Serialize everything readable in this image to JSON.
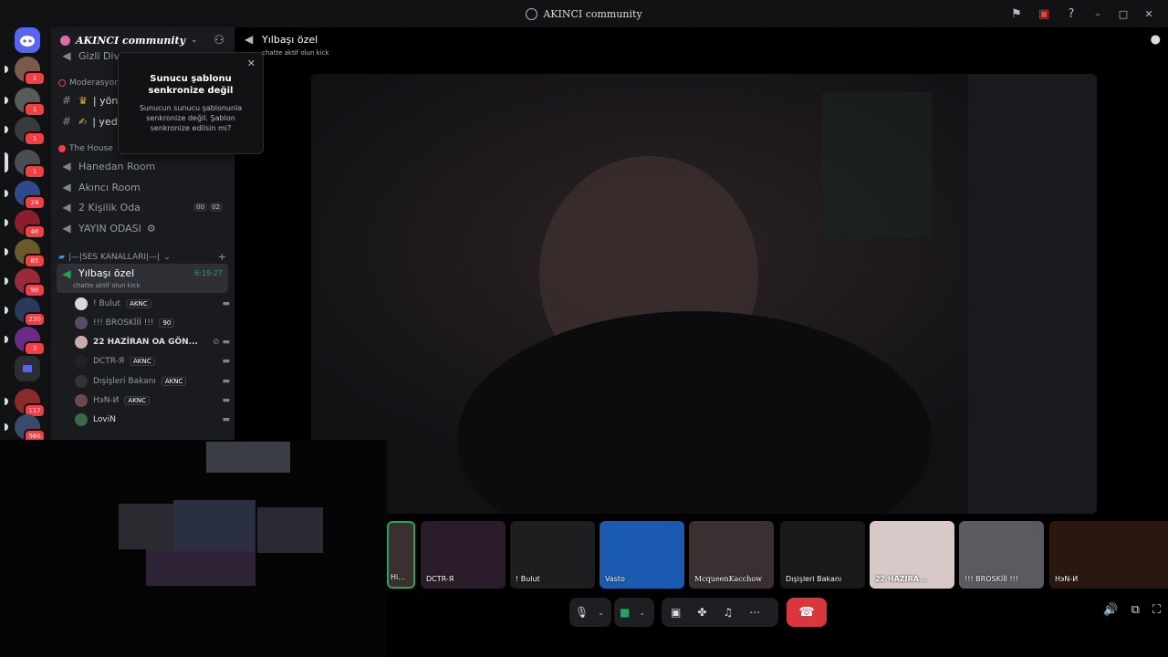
{
  "window": {
    "title": "AKINCI community",
    "icons": [
      "flag-icon",
      "screen-share-icon",
      "help-icon",
      "minimize-icon",
      "maximize-icon",
      "close-icon"
    ]
  },
  "rail": {
    "badges": [
      "1",
      "1",
      "1",
      "1",
      "24",
      "46",
      "85",
      "98",
      "220",
      "3",
      "117",
      "566"
    ]
  },
  "guild": {
    "name": "AKINCI community"
  },
  "channels": {
    "gizli": "Gizli Divan",
    "cat_moderasyon": "Moderasyon",
    "yonetim": "| yönet",
    "yedek": "| yedek",
    "cat_house": "The House",
    "hanedan": "Hanedan Room",
    "akinci_room": "Akıncı Room",
    "iki_kisilik": "2 Kişilik Oda",
    "iki_kisilik_counts": [
      "00",
      "02"
    ],
    "yayin": "YAYIN ODASI",
    "cat_ses": "|—|SES KANALLARI|—|",
    "active": {
      "name": "Yılbaşı özel",
      "timer": "6:19:27",
      "status": "chatte aktif olun kick"
    }
  },
  "voice_users": [
    {
      "name": "! Bulut",
      "tag": "AKNC"
    },
    {
      "name": "!!! BROSKİİİ !!!",
      "tag": "90"
    },
    {
      "name": "22 HAZİRAN OA GÖN...",
      "tag": ""
    },
    {
      "name": "DCTR-Я",
      "tag": "AKNC"
    },
    {
      "name": "Dışişleri Bakanı",
      "tag": "AKNC"
    },
    {
      "name": "HэN-И",
      "tag": "AKNC"
    },
    {
      "name": "LoviN",
      "tag": ""
    }
  ],
  "popup": {
    "title": "Sunucu şablonu senkronize değil",
    "body": "Sunucun sunucu şablonunla senkronize değil. Şablon senkronize edilsin mi?"
  },
  "call": {
    "title": "Yılbaşı özel",
    "status": "chatte aktif olun kick"
  },
  "tiles": [
    {
      "label": "Hi..."
    },
    {
      "label": "DCTR-Я"
    },
    {
      "label": "! Bulut"
    },
    {
      "label": "Vasto"
    },
    {
      "label": "McqueenKacchow"
    },
    {
      "label": "Dışişleri Bakanı"
    },
    {
      "label": "22 HAZİRA..."
    },
    {
      "label": "!!! BROSKİİİ !!!"
    },
    {
      "label": "HэN-И"
    }
  ],
  "colors": {
    "accent_green": "#23a55a",
    "danger": "#da373c",
    "badge": "#f23f43",
    "blurple": "#5865f2"
  }
}
